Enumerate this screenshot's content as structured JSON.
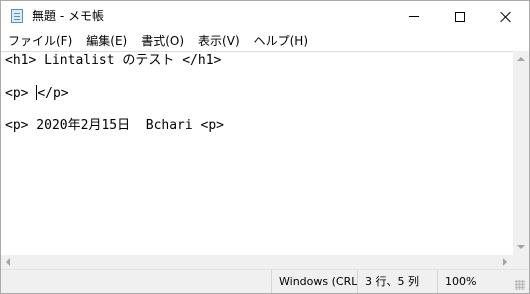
{
  "window": {
    "title": "無題 - メモ帳"
  },
  "menu": {
    "items": [
      {
        "label": "ファイル(F)"
      },
      {
        "label": "編集(E)"
      },
      {
        "label": "書式(O)"
      },
      {
        "label": "表示(V)"
      },
      {
        "label": "ヘルプ(H)"
      }
    ]
  },
  "editor": {
    "line1": "<h1> Lintalist のテスト </h1>",
    "line3_before": "<p> ",
    "line3_after": "</p>",
    "line5": "<p> 2020年2月15日  Bchari <p>"
  },
  "status": {
    "encoding": "Windows (CRL",
    "position": "3 行、5 列",
    "zoom": "100%"
  },
  "icons": {
    "app": "notepad-icon",
    "minimize": "minimize-icon",
    "maximize": "maximize-icon",
    "close": "close-icon"
  }
}
